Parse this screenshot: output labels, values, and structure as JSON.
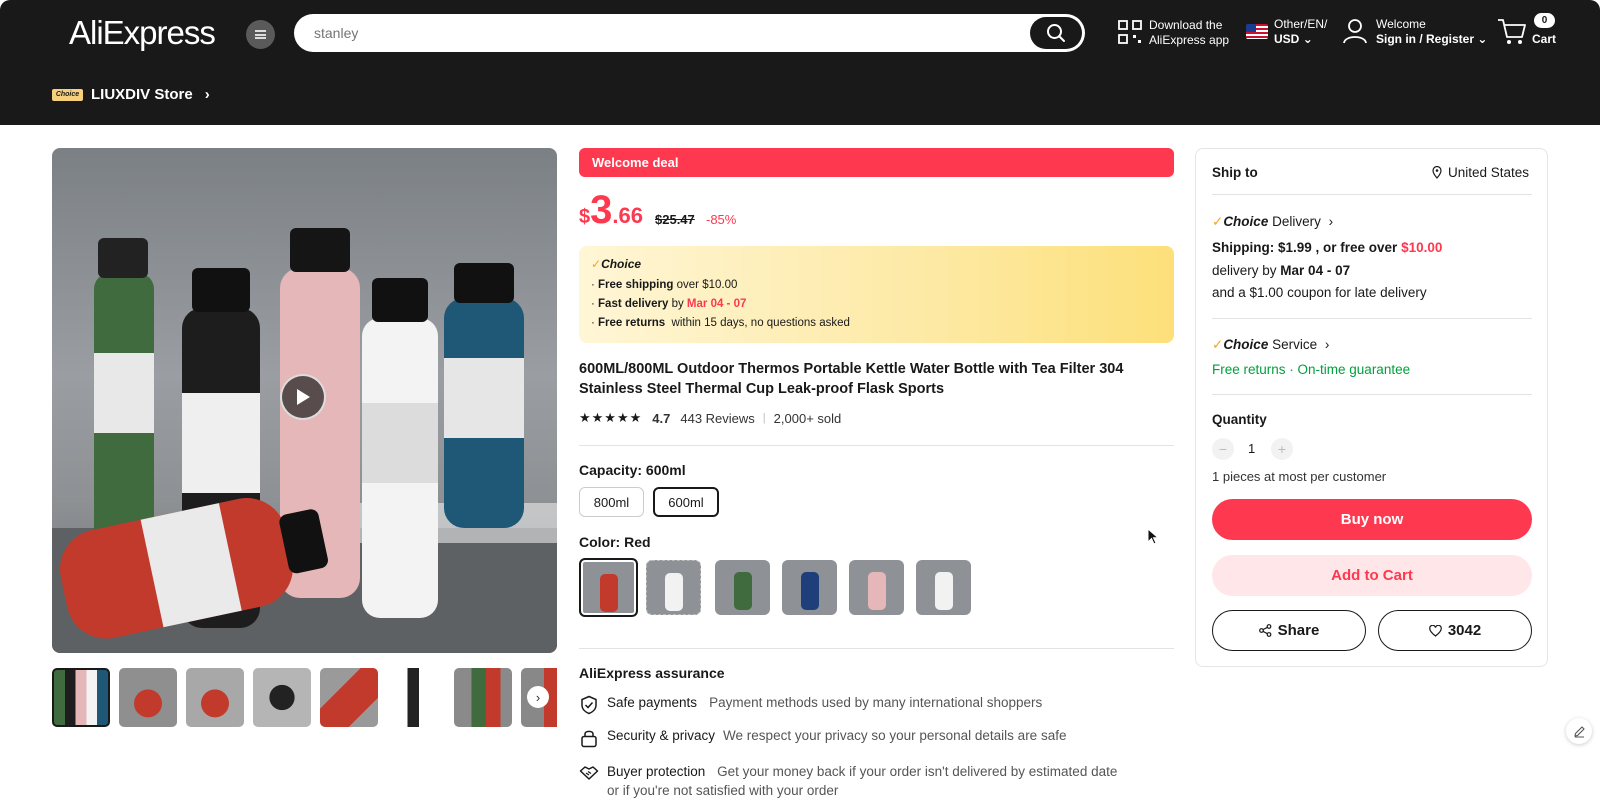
{
  "header": {
    "logo": "AliExpress",
    "search_placeholder": "stanley",
    "download_line1": "Download the",
    "download_line2": "AliExpress app",
    "locale_line1": "Other/EN/",
    "locale_line2": "USD",
    "account_line1": "Welcome",
    "account_line2": "Sign in / Register",
    "cart_count": "0",
    "cart_label": "Cart"
  },
  "store": {
    "choice_tag": "Choice",
    "name": "LIUXDIV Store"
  },
  "deal": {
    "label": "Welcome deal"
  },
  "price": {
    "currency": "$",
    "integer": "3",
    "decimal": ".66",
    "original": "$25.47",
    "discount": "-85%"
  },
  "choice_box": {
    "title": "Choice",
    "line1_bold": "Free shipping",
    "line1_rest": "over $10.00",
    "line2_bold": "Fast delivery",
    "line2_mid": "by",
    "line2_date": "Mar 04 - 07",
    "line3_bold": "Free returns",
    "line3_rest": "within 15 days, no questions asked"
  },
  "product": {
    "title": "600ML/800ML Outdoor Thermos Portable Kettle Water Bottle with Tea Filter 304 Stainless Steel Thermal Cup Leak-proof Flask Sports",
    "rating_value": 4.7,
    "rating": "4.7",
    "reviews": "443 Reviews",
    "sold": "2,000+ sold"
  },
  "capacity": {
    "label": "Capacity: 600ml",
    "options": [
      "800ml",
      "600ml"
    ],
    "selected": "600ml"
  },
  "color": {
    "label": "Color: Red",
    "swatch_colors": [
      "#c23a2c",
      "#e7e7e7",
      "#3f6b3e",
      "#1f3f7a",
      "#e5b7b8",
      "#f2f2f2"
    ]
  },
  "assurance": {
    "title": "AliExpress assurance",
    "items": [
      {
        "name": "Safe payments",
        "desc": "Payment methods used by many international shoppers"
      },
      {
        "name": "Security & privacy",
        "desc": "We respect your privacy so your personal details are safe"
      },
      {
        "name": "Buyer protection",
        "desc": "Get your money back if your order isn't delivered by estimated date",
        "desc2": "or if you're not satisfied with your order"
      }
    ]
  },
  "shipping": {
    "ship_to_label": "Ship to",
    "country": "United States",
    "delivery_brand": "Choice",
    "delivery_label": "Delivery",
    "shipping_text": "Shipping: $1.99 , or free over",
    "free_threshold": "$10.00",
    "delivery_by": "delivery by",
    "delivery_dates": "Mar 04 - 07",
    "coupon_text": "and a $1.00 coupon for late delivery",
    "service_brand": "Choice",
    "service_label": "Service",
    "free_returns": "Free returns",
    "on_time": "On-time guarantee"
  },
  "quantity": {
    "label": "Quantity",
    "value": "1",
    "limit": "1 pieces at most per customer"
  },
  "actions": {
    "buy_now": "Buy now",
    "add_to_cart": "Add to Cart",
    "share": "Share",
    "wishlist_count": "3042"
  },
  "colors": {
    "accent": "#fd384f",
    "header_bg": "#191919",
    "green": "#00a03c"
  }
}
